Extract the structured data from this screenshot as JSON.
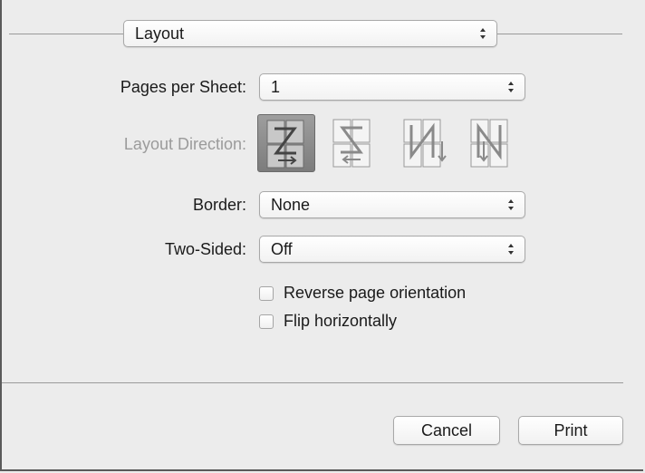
{
  "panel_selector": {
    "value": "Layout"
  },
  "fields": {
    "pages_per_sheet": {
      "label": "Pages per Sheet:",
      "value": "1"
    },
    "layout_direction": {
      "label": "Layout Direction:",
      "options": [
        {
          "icon": "z-order-icon",
          "selected": true
        },
        {
          "icon": "reverse-z-order-icon",
          "selected": false
        },
        {
          "icon": "n-order-icon",
          "selected": false
        },
        {
          "icon": "reverse-n-order-icon",
          "selected": false
        }
      ]
    },
    "border": {
      "label": "Border:",
      "value": "None"
    },
    "two_sided": {
      "label": "Two-Sided:",
      "value": "Off"
    }
  },
  "checkboxes": {
    "reverse_orientation": {
      "label": "Reverse page orientation",
      "checked": false
    },
    "flip_horizontally": {
      "label": "Flip horizontally",
      "checked": false
    }
  },
  "buttons": {
    "cancel": "Cancel",
    "print": "Print"
  }
}
